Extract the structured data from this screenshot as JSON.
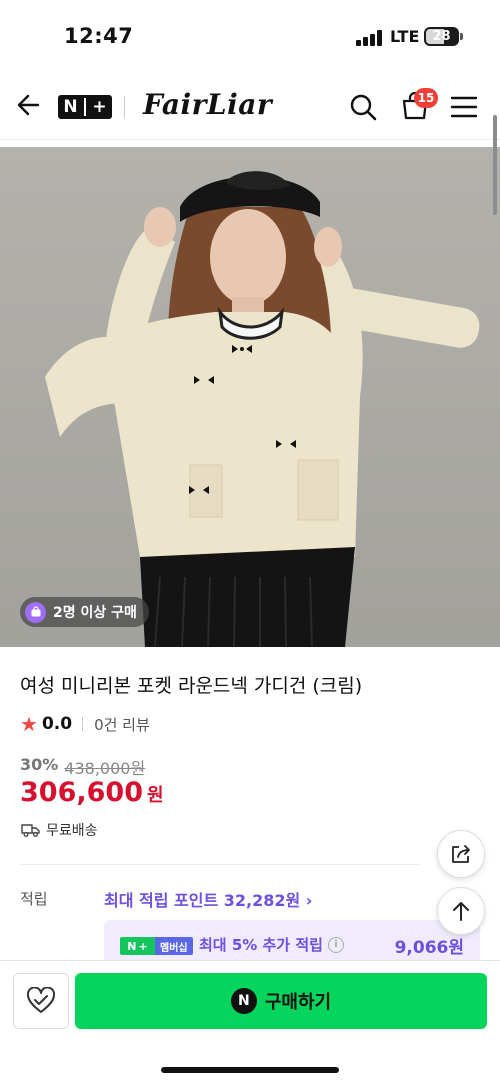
{
  "status_bar": {
    "time": "12:47",
    "network": "LTE",
    "battery": "28"
  },
  "header": {
    "brand": "FairLiar",
    "cart_count": "15",
    "icons": [
      "back-arrow-icon",
      "nplus-logo",
      "search-icon",
      "cart-icon",
      "menu-icon"
    ]
  },
  "hero": {
    "purchase_chip": "2명 이상 구매"
  },
  "product": {
    "title": "여성 미니리본 포켓 라운드넥 가디건 (크림)",
    "rating": "0.0",
    "review_count": "0건 리뷰",
    "discount": "30%",
    "original_price": "438,000원",
    "price": "306,600",
    "currency": "원",
    "shipping": "무료배송"
  },
  "points": {
    "label": "적립",
    "link": "최대 적립 포인트 32,282원",
    "member_badge_n": "N",
    "member_badge_plus": "+",
    "member_badge": "멤버십",
    "member_text": "최대 5% 추가 적립",
    "member_value": "9,066원"
  },
  "bottom": {
    "buy_label": "구매하기",
    "buy_icon_letter": "N"
  },
  "colors": {
    "price_red": "#d7102e",
    "accent_purple": "#6e4fde",
    "buy_green": "#05d55c",
    "badge_red": "#ef3f36"
  }
}
